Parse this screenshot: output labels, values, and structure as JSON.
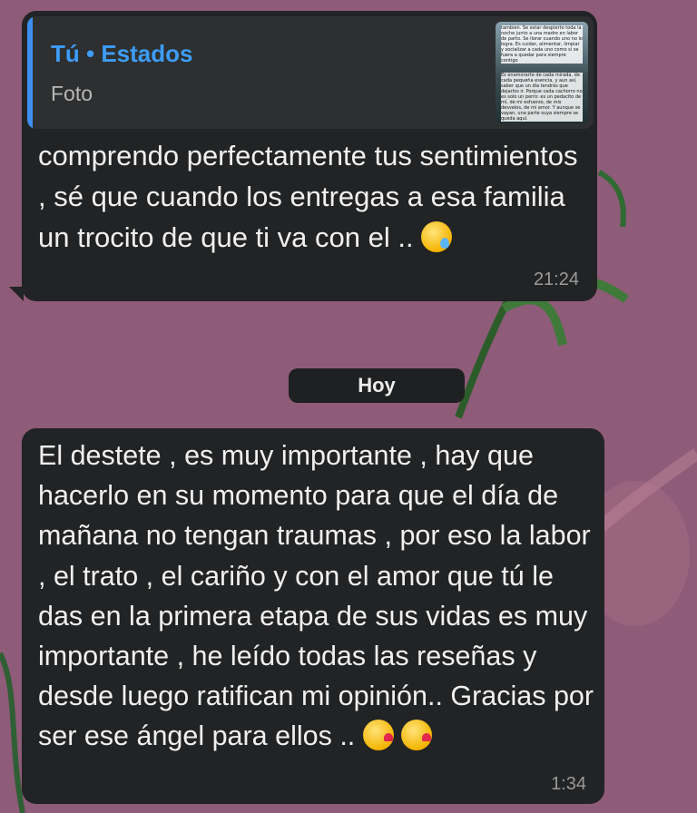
{
  "messages": [
    {
      "reply": {
        "author": "Tú • Estados",
        "type": "Foto",
        "thumbnail_text_top": "tambien. Se estar despierto toda la noche junto a una madre en labor de parto. Se llorar cuando uno no lo logra. Es cuidar, alimentar, limpiar y socializar a cada uno como si se fuera a quedar para siempre contigo",
        "thumbnail_text_bottom": "Es enamorarte de cada mirada, de cada pequeña esencia, y aun así, saber que un día tendrás que dejarlos ir. Porque cada cachorro no es solo un perro: es un pedacito de mí, de mi esfuerzo, de mis desvelos, de mi amor. Y aunque se vayan, una parte suya siempre se queda aquí."
      },
      "text": "comprendo perfectamente tus sentimientos , sé que cuando los entregas a esa familia un trocito de que ti va con el .. ",
      "emoji": "crying-face",
      "time": "21:24"
    },
    {
      "text": "El destete , es muy importante , hay que hacerlo en su momento para que el día de mañana no tengan traumas , por eso la labor , el trato , el cariño y con el amor que tú le das en la primera etapa de sus vidas es muy importante , he leído todas las reseñas y desde luego ratifican mi opinión.. Gracias por ser ese ángel para ellos .. ",
      "emoji": "kissing-face",
      "time": "1:34"
    }
  ],
  "date_chip": "Hoy",
  "colors": {
    "background": "#8e5b78",
    "bubble": "#222324",
    "accent": "#3d9df8"
  }
}
